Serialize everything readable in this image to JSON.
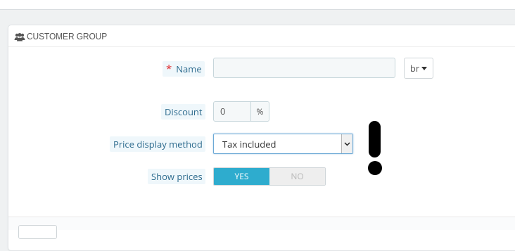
{
  "panel": {
    "title": "CUSTOMER GROUP",
    "icon": "users-icon"
  },
  "form": {
    "name": {
      "required_mark": "*",
      "label": "Name",
      "value": "",
      "language": "br"
    },
    "discount": {
      "label": "Discount",
      "value": "0",
      "addon": "%"
    },
    "price_display": {
      "label": "Price display method",
      "selected": "Tax included"
    },
    "show_prices": {
      "label": "Show prices",
      "yes": "YES",
      "no": "NO",
      "selected": "YES"
    }
  },
  "colors": {
    "accent": "#2eacce",
    "label_bg": "#eff7fb",
    "label_text": "#2d6b8e",
    "required": "#e0272b"
  }
}
